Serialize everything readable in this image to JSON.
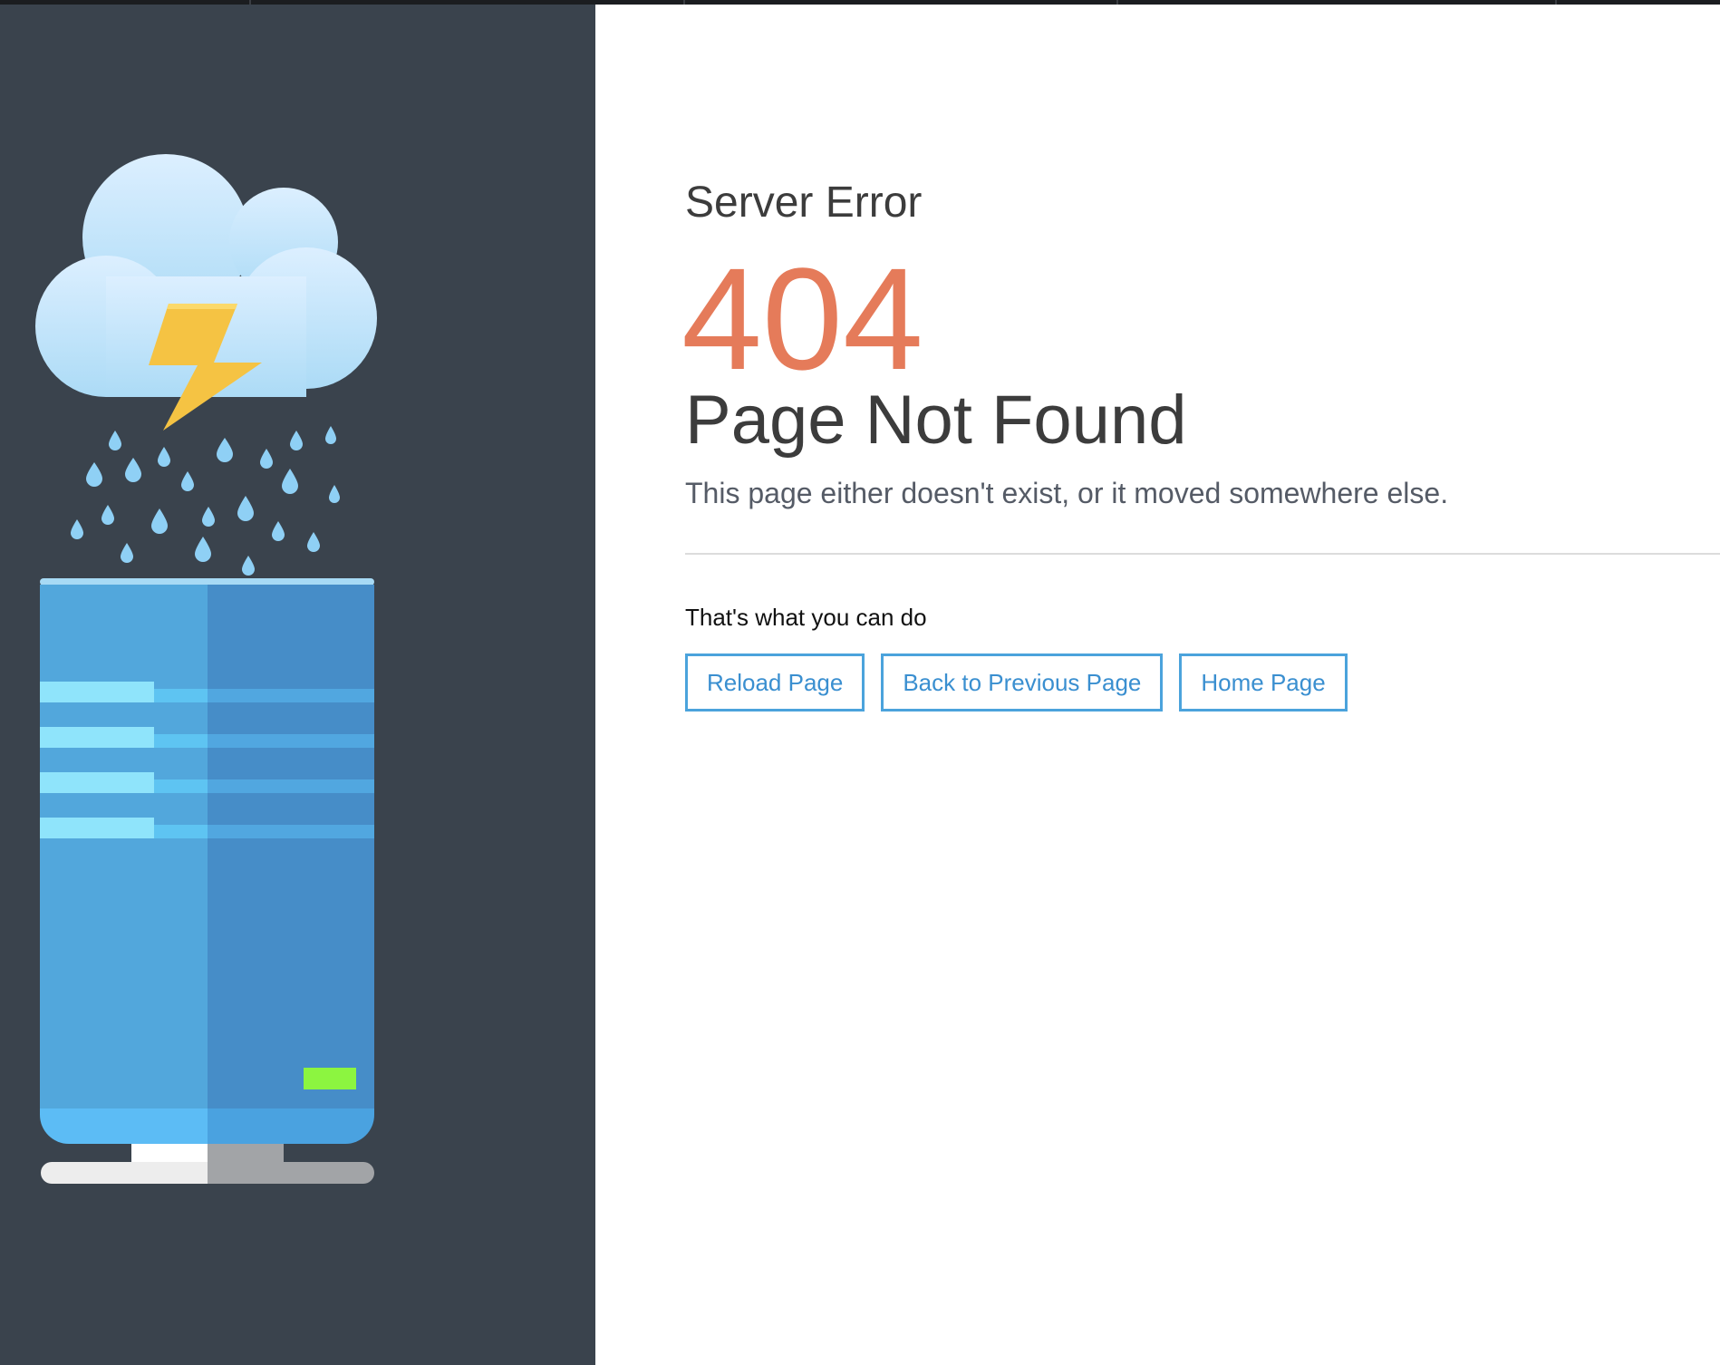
{
  "error": {
    "title": "Server Error",
    "code": "404",
    "heading": "Page Not Found",
    "description": "This page either doesn't exist, or it moved somewhere else."
  },
  "actions": {
    "title": "That's what you can do",
    "buttons": [
      {
        "label": "Reload Page"
      },
      {
        "label": "Back to Previous Page"
      },
      {
        "label": "Home Page"
      }
    ]
  },
  "illustration": {
    "description_icon": "cloud-storm-server-illustration",
    "colors": {
      "panel_bg": "#3a434d",
      "cloud": "#bfe2f8",
      "lightning": "#f5c343",
      "rain": "#8fd0f5",
      "server_light": "#52a7dc",
      "server_dark": "#468dc8",
      "status_led": "#8cf540"
    }
  },
  "colors": {
    "accent": "#4ba3dc",
    "error_code": "#e57b5a",
    "heading": "#3c3c3c"
  }
}
